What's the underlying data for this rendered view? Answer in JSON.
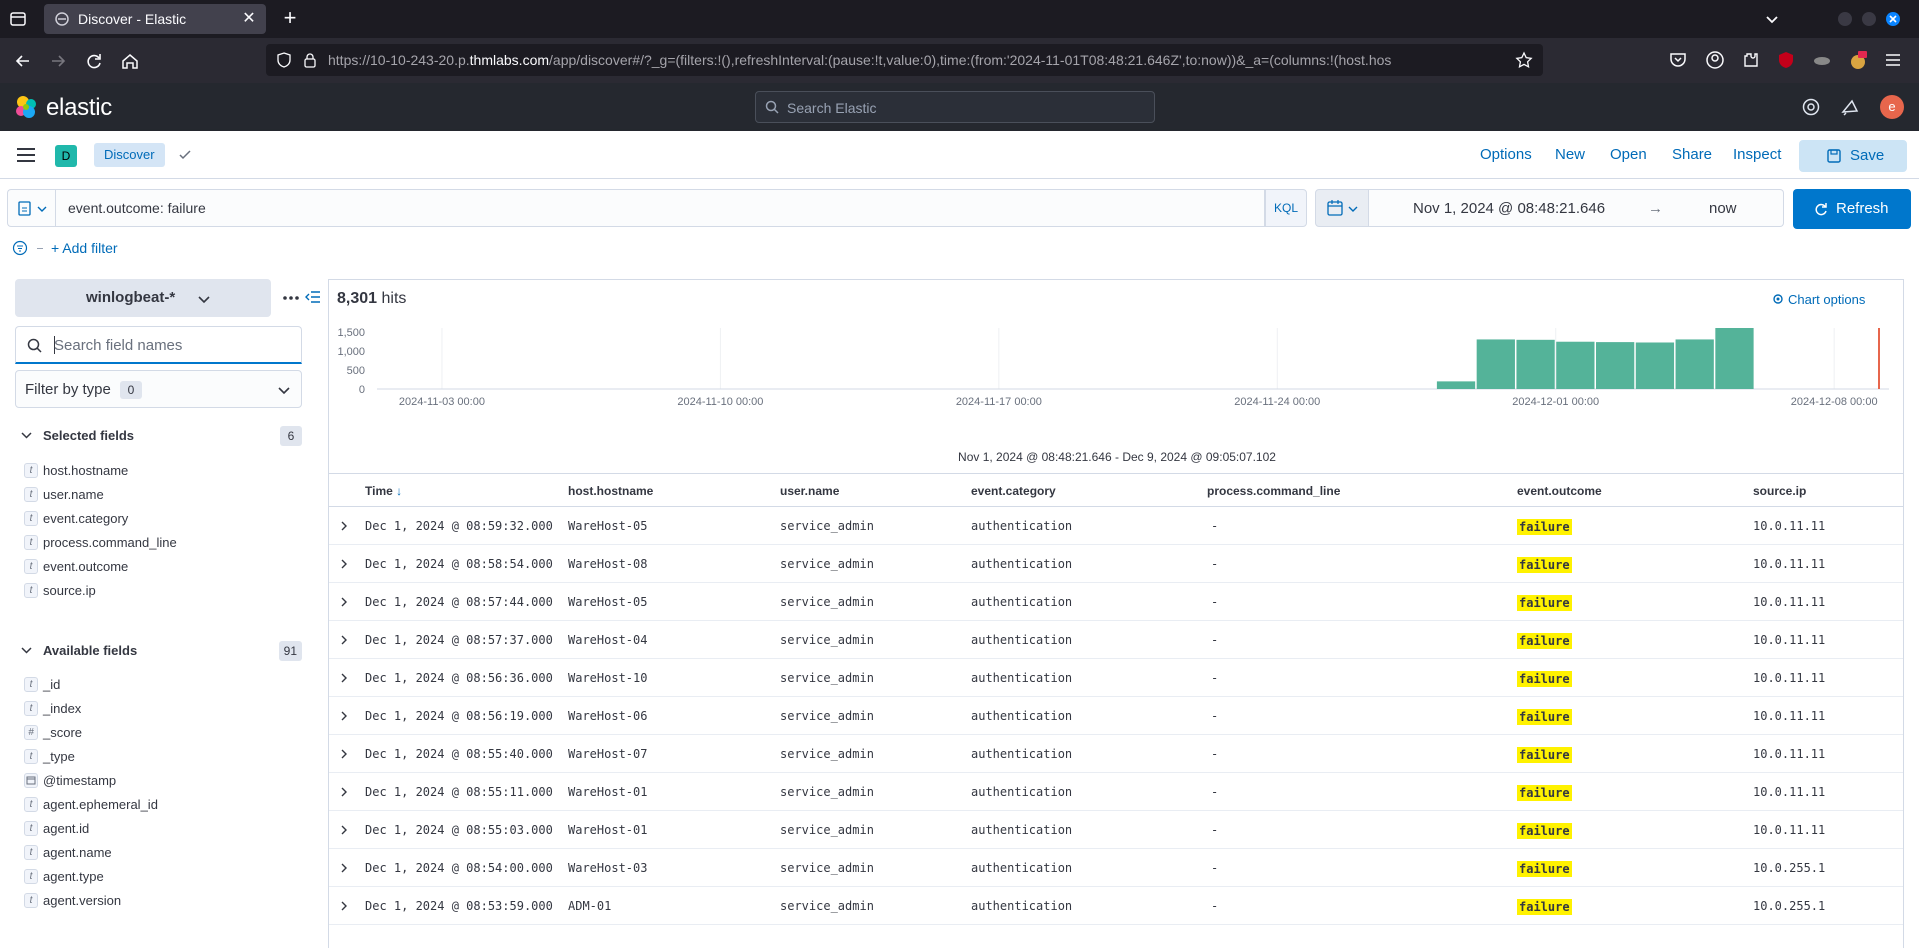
{
  "browser": {
    "tab_title": "Discover - Elastic",
    "url_prefix": "https://10-10-243-20.p.",
    "url_domain": "thmlabs.com",
    "url_suffix": "/app/discover#/?_g=(filters:!(),refreshInterval:(pause:!t,value:0),time:(from:'2024-11-01T08:48:21.646Z',to:now))&_a=(columns:!(host.hos"
  },
  "elastic_header": {
    "brand": "elastic",
    "search_placeholder": "Search Elastic",
    "avatar_letter": "e"
  },
  "appbar": {
    "space_letter": "D",
    "breadcrumb": "Discover",
    "links": [
      "Options",
      "New",
      "Open",
      "Share",
      "Inspect"
    ],
    "save_label": "Save"
  },
  "query": {
    "text": "event.outcome: failure",
    "language": "KQL",
    "start": "Nov 1, 2024 @ 08:48:21.646",
    "arrow": "→",
    "end": "now",
    "refresh_label": "Refresh",
    "add_filter": "+ Add filter"
  },
  "sidebar": {
    "index_pattern": "winlogbeat-*",
    "search_placeholder": "Search field names",
    "filter_by_type": "Filter by type",
    "filter_count": "0",
    "selected_label": "Selected fields",
    "selected_count": "6",
    "selected_fields": [
      {
        "type": "t",
        "name": "host.hostname"
      },
      {
        "type": "t",
        "name": "user.name"
      },
      {
        "type": "t",
        "name": "event.category"
      },
      {
        "type": "t",
        "name": "process.command_line"
      },
      {
        "type": "t",
        "name": "event.outcome"
      },
      {
        "type": "t",
        "name": "source.ip"
      }
    ],
    "available_label": "Available fields",
    "available_count": "91",
    "available_fields": [
      {
        "type": "t",
        "name": "_id"
      },
      {
        "type": "t",
        "name": "_index"
      },
      {
        "type": "#",
        "name": "_score"
      },
      {
        "type": "t",
        "name": "_type"
      },
      {
        "type": "date",
        "name": "@timestamp"
      },
      {
        "type": "t",
        "name": "agent.ephemeral_id"
      },
      {
        "type": "t",
        "name": "agent.id"
      },
      {
        "type": "t",
        "name": "agent.name"
      },
      {
        "type": "t",
        "name": "agent.type"
      },
      {
        "type": "t",
        "name": "agent.version"
      }
    ]
  },
  "main": {
    "hits_count": "8,301",
    "hits_label": "hits",
    "chart_options": "Chart options",
    "range_caption": "Nov 1, 2024 @ 08:48:21.646 - Dec 9, 2024 @ 09:05:07.102",
    "columns": [
      "Time",
      "host.hostname",
      "user.name",
      "event.category",
      "process.command_line",
      "event.outcome",
      "source.ip"
    ],
    "sort_indicator": "↓",
    "rows": [
      {
        "time": "Dec 1, 2024 @ 08:59:32.000",
        "host": "WareHost-05",
        "user": "service_admin",
        "category": "authentication",
        "cmd": "-",
        "outcome": "failure",
        "ip": "10.0.11.11"
      },
      {
        "time": "Dec 1, 2024 @ 08:58:54.000",
        "host": "WareHost-08",
        "user": "service_admin",
        "category": "authentication",
        "cmd": "-",
        "outcome": "failure",
        "ip": "10.0.11.11"
      },
      {
        "time": "Dec 1, 2024 @ 08:57:44.000",
        "host": "WareHost-05",
        "user": "service_admin",
        "category": "authentication",
        "cmd": "-",
        "outcome": "failure",
        "ip": "10.0.11.11"
      },
      {
        "time": "Dec 1, 2024 @ 08:57:37.000",
        "host": "WareHost-04",
        "user": "service_admin",
        "category": "authentication",
        "cmd": "-",
        "outcome": "failure",
        "ip": "10.0.11.11"
      },
      {
        "time": "Dec 1, 2024 @ 08:56:36.000",
        "host": "WareHost-10",
        "user": "service_admin",
        "category": "authentication",
        "cmd": "-",
        "outcome": "failure",
        "ip": "10.0.11.11"
      },
      {
        "time": "Dec 1, 2024 @ 08:56:19.000",
        "host": "WareHost-06",
        "user": "service_admin",
        "category": "authentication",
        "cmd": "-",
        "outcome": "failure",
        "ip": "10.0.11.11"
      },
      {
        "time": "Dec 1, 2024 @ 08:55:40.000",
        "host": "WareHost-07",
        "user": "service_admin",
        "category": "authentication",
        "cmd": "-",
        "outcome": "failure",
        "ip": "10.0.11.11"
      },
      {
        "time": "Dec 1, 2024 @ 08:55:11.000",
        "host": "WareHost-01",
        "user": "service_admin",
        "category": "authentication",
        "cmd": "-",
        "outcome": "failure",
        "ip": "10.0.11.11"
      },
      {
        "time": "Dec 1, 2024 @ 08:55:03.000",
        "host": "WareHost-01",
        "user": "service_admin",
        "category": "authentication",
        "cmd": "-",
        "outcome": "failure",
        "ip": "10.0.11.11"
      },
      {
        "time": "Dec 1, 2024 @ 08:54:00.000",
        "host": "WareHost-03",
        "user": "service_admin",
        "category": "authentication",
        "cmd": "-",
        "outcome": "failure",
        "ip": "10.0.255.1"
      },
      {
        "time": "Dec 1, 2024 @ 08:53:59.000",
        "host": "ADM-01",
        "user": "service_admin",
        "category": "authentication",
        "cmd": "-",
        "outcome": "failure",
        "ip": "10.0.255.1"
      }
    ]
  },
  "chart_data": {
    "type": "bar",
    "title": "",
    "xlabel": "",
    "ylabel": "",
    "x_tick_labels": [
      "2024-11-03 00:00",
      "2024-11-10 00:00",
      "2024-11-17 00:00",
      "2024-11-24 00:00",
      "2024-12-01 00:00",
      "2024-12-08 00:00"
    ],
    "y_tick_labels": [
      "1,500",
      "1,000",
      "500",
      "0"
    ],
    "ylim": [
      0,
      1600
    ],
    "grid": true,
    "bar_color": "#54b399",
    "now_marker_color": "#e7664c",
    "categories": [
      "2024-11-28",
      "2024-11-29",
      "2024-11-30",
      "2024-12-01",
      "2024-12-02",
      "2024-12-03",
      "2024-12-04",
      "2024-12-05"
    ],
    "values": [
      200,
      1300,
      1290,
      1240,
      1230,
      1220,
      1300,
      1600
    ]
  }
}
